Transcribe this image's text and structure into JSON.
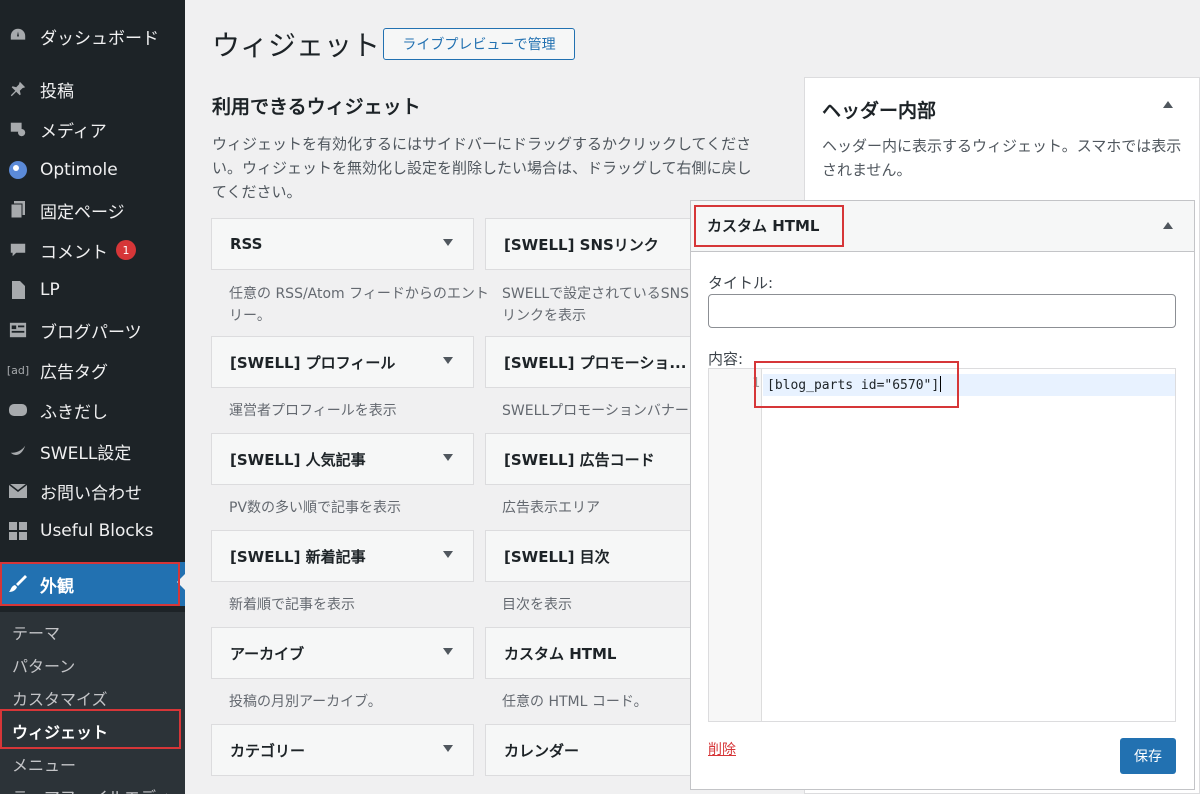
{
  "sidebar": {
    "items": [
      {
        "label": "ダッシュボード",
        "icon": "dashboard-icon"
      },
      {
        "label": "投稿",
        "icon": "pin-icon"
      },
      {
        "label": "メディア",
        "icon": "media-icon"
      },
      {
        "label": "Optimole",
        "icon": "optimole-icon"
      },
      {
        "label": "固定ページ",
        "icon": "page-icon"
      },
      {
        "label": "コメント",
        "icon": "comment-icon",
        "badge": "1"
      },
      {
        "label": "LP",
        "icon": "document-icon"
      },
      {
        "label": "ブログパーツ",
        "icon": "blog-parts-icon"
      },
      {
        "label": "広告タグ",
        "icon": "ad-icon",
        "icon_text": "[ad]"
      },
      {
        "label": "ふきだし",
        "icon": "balloon-icon"
      },
      {
        "label": "SWELL設定",
        "icon": "swell-icon"
      },
      {
        "label": "お問い合わせ",
        "icon": "mail-icon"
      },
      {
        "label": "Useful Blocks",
        "icon": "blocks-icon"
      },
      {
        "label": "外観",
        "icon": "brush-icon"
      }
    ],
    "submenu": [
      "テーマ",
      "パターン",
      "カスタマイズ",
      "ウィジェット",
      "メニュー",
      "テーマファイルエディター"
    ]
  },
  "header": {
    "title": "ウィジェット",
    "preview_button": "ライブプレビューで管理"
  },
  "available": {
    "heading": "利用できるウィジェット",
    "description": "ウィジェットを有効化するにはサイドバーにドラッグするかクリックしてください。ウィジェットを無効化し設定を削除したい場合は、ドラッグして右側に戻してください。",
    "widgets": [
      {
        "name": "RSS",
        "desc": "任意の RSS/Atom フィードからのエントリー。"
      },
      {
        "name": "[SWELL] SNSリンク",
        "desc": "SWELLで設定されているSNSリンクを表示"
      },
      {
        "name": "[SWELL] プロフィール",
        "desc": "運営者プロフィールを表示"
      },
      {
        "name": "[SWELL] プロモーショ...",
        "desc": "SWELLプロモーションバナーを表示"
      },
      {
        "name": "[SWELL] 人気記事",
        "desc": "PV数の多い順で記事を表示"
      },
      {
        "name": "[SWELL] 広告コード",
        "desc": "広告表示エリア"
      },
      {
        "name": "[SWELL] 新着記事",
        "desc": "新着順で記事を表示"
      },
      {
        "name": "[SWELL] 目次",
        "desc": "目次を表示"
      },
      {
        "name": "アーカイブ",
        "desc": "投稿の月別アーカイブ。"
      },
      {
        "name": "カスタム HTML",
        "desc": "任意の HTML コード。"
      },
      {
        "name": "カテゴリー",
        "desc": ""
      },
      {
        "name": "カレンダー",
        "desc": ""
      }
    ]
  },
  "area": {
    "title": "ヘッダー内部",
    "description": "ヘッダー内に表示するウィジェット。スマホでは表示されません。"
  },
  "panel": {
    "title": "カスタム HTML",
    "title_label": "タイトル:",
    "title_value": "",
    "content_label": "内容:",
    "line_number": "1",
    "code": "[blog_parts id=\"6570\"]",
    "delete_label": "削除",
    "save_label": "保存"
  },
  "colors": {
    "sidebar_bg": "#1d2327",
    "accent": "#2271b1",
    "highlight_box": "#d63638",
    "badge": "#d63638"
  }
}
